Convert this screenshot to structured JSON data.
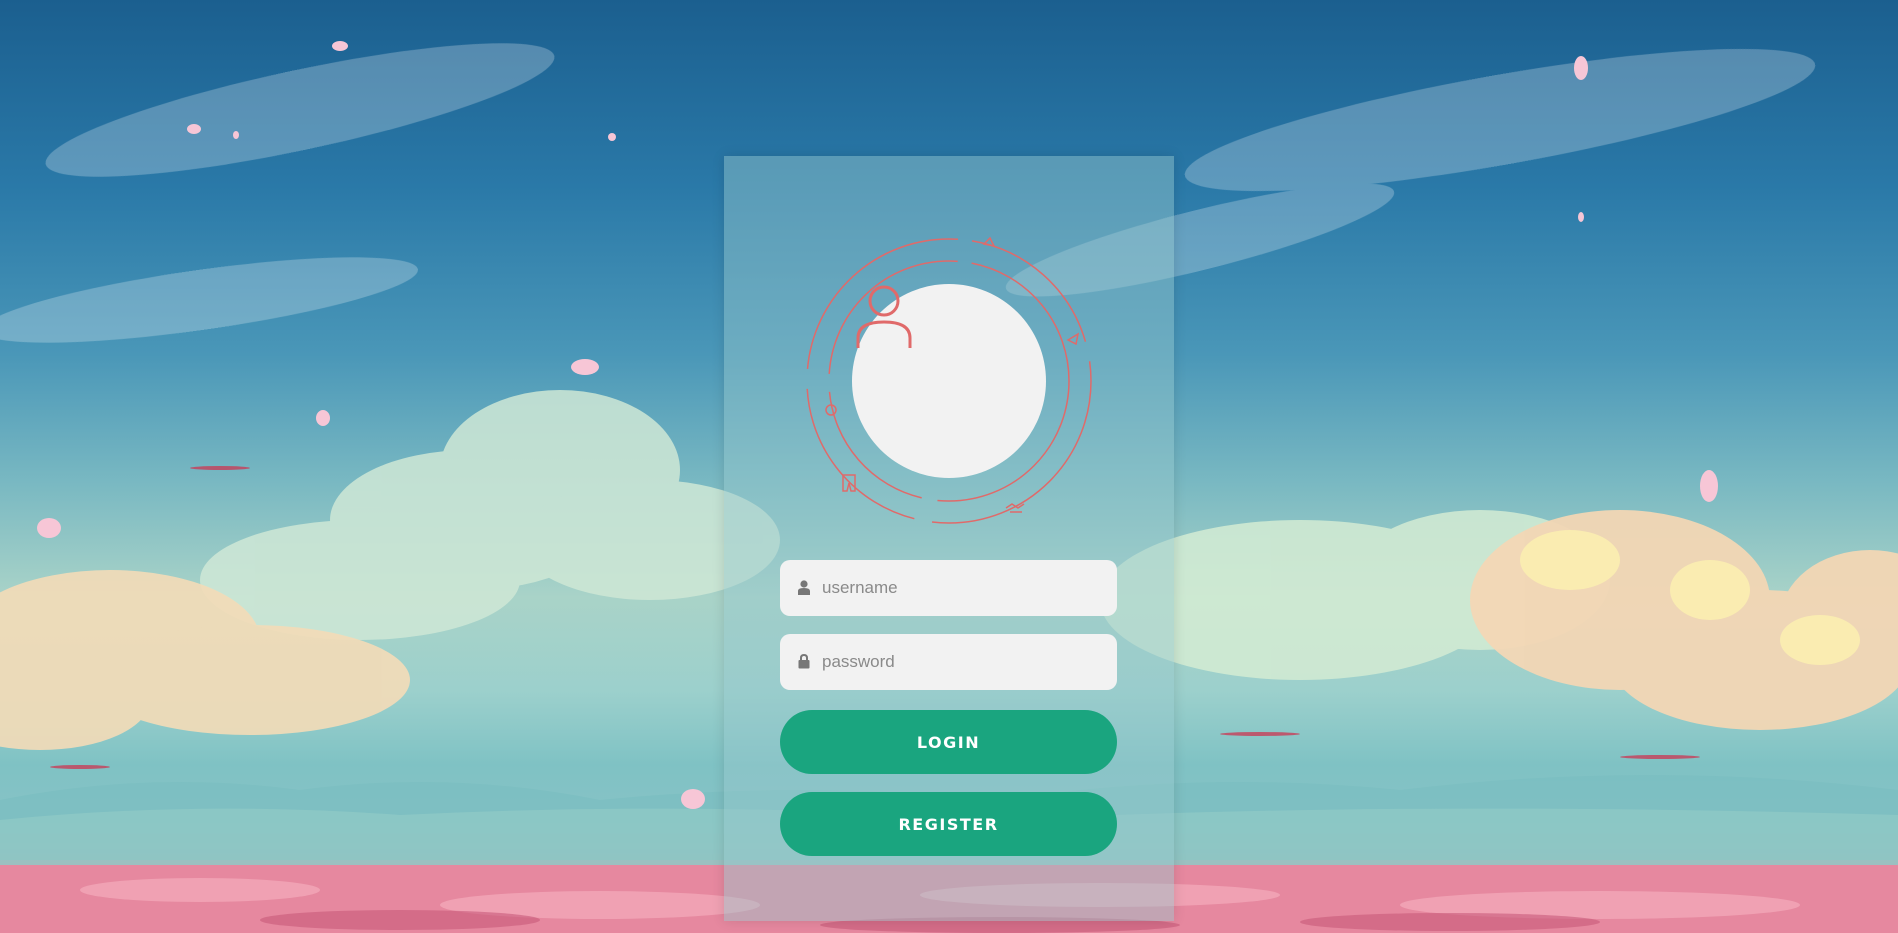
{
  "login_form": {
    "username": {
      "placeholder": "username",
      "value": "",
      "icon": "user-icon"
    },
    "password": {
      "placeholder": "password",
      "value": "",
      "icon": "lock-icon"
    },
    "login_label": "LOGIN",
    "register_label": "REGISTER"
  },
  "avatar": {
    "icon": "user-outline-icon"
  },
  "colors": {
    "button": "#1aa57f",
    "accent": "#e06a6a",
    "field_bg": "#f2f2f2",
    "avatar_bg": "#f2f2f2"
  }
}
